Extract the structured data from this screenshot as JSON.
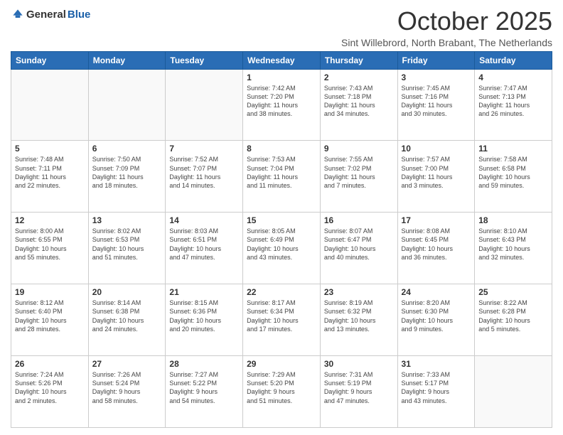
{
  "logo": {
    "general": "General",
    "blue": "Blue"
  },
  "title": "October 2025",
  "location": "Sint Willebrord, North Brabant, The Netherlands",
  "days_of_week": [
    "Sunday",
    "Monday",
    "Tuesday",
    "Wednesday",
    "Thursday",
    "Friday",
    "Saturday"
  ],
  "weeks": [
    [
      {
        "day": "",
        "info": ""
      },
      {
        "day": "",
        "info": ""
      },
      {
        "day": "",
        "info": ""
      },
      {
        "day": "1",
        "info": "Sunrise: 7:42 AM\nSunset: 7:20 PM\nDaylight: 11 hours\nand 38 minutes."
      },
      {
        "day": "2",
        "info": "Sunrise: 7:43 AM\nSunset: 7:18 PM\nDaylight: 11 hours\nand 34 minutes."
      },
      {
        "day": "3",
        "info": "Sunrise: 7:45 AM\nSunset: 7:16 PM\nDaylight: 11 hours\nand 30 minutes."
      },
      {
        "day": "4",
        "info": "Sunrise: 7:47 AM\nSunset: 7:13 PM\nDaylight: 11 hours\nand 26 minutes."
      }
    ],
    [
      {
        "day": "5",
        "info": "Sunrise: 7:48 AM\nSunset: 7:11 PM\nDaylight: 11 hours\nand 22 minutes."
      },
      {
        "day": "6",
        "info": "Sunrise: 7:50 AM\nSunset: 7:09 PM\nDaylight: 11 hours\nand 18 minutes."
      },
      {
        "day": "7",
        "info": "Sunrise: 7:52 AM\nSunset: 7:07 PM\nDaylight: 11 hours\nand 14 minutes."
      },
      {
        "day": "8",
        "info": "Sunrise: 7:53 AM\nSunset: 7:04 PM\nDaylight: 11 hours\nand 11 minutes."
      },
      {
        "day": "9",
        "info": "Sunrise: 7:55 AM\nSunset: 7:02 PM\nDaylight: 11 hours\nand 7 minutes."
      },
      {
        "day": "10",
        "info": "Sunrise: 7:57 AM\nSunset: 7:00 PM\nDaylight: 11 hours\nand 3 minutes."
      },
      {
        "day": "11",
        "info": "Sunrise: 7:58 AM\nSunset: 6:58 PM\nDaylight: 10 hours\nand 59 minutes."
      }
    ],
    [
      {
        "day": "12",
        "info": "Sunrise: 8:00 AM\nSunset: 6:55 PM\nDaylight: 10 hours\nand 55 minutes."
      },
      {
        "day": "13",
        "info": "Sunrise: 8:02 AM\nSunset: 6:53 PM\nDaylight: 10 hours\nand 51 minutes."
      },
      {
        "day": "14",
        "info": "Sunrise: 8:03 AM\nSunset: 6:51 PM\nDaylight: 10 hours\nand 47 minutes."
      },
      {
        "day": "15",
        "info": "Sunrise: 8:05 AM\nSunset: 6:49 PM\nDaylight: 10 hours\nand 43 minutes."
      },
      {
        "day": "16",
        "info": "Sunrise: 8:07 AM\nSunset: 6:47 PM\nDaylight: 10 hours\nand 40 minutes."
      },
      {
        "day": "17",
        "info": "Sunrise: 8:08 AM\nSunset: 6:45 PM\nDaylight: 10 hours\nand 36 minutes."
      },
      {
        "day": "18",
        "info": "Sunrise: 8:10 AM\nSunset: 6:43 PM\nDaylight: 10 hours\nand 32 minutes."
      }
    ],
    [
      {
        "day": "19",
        "info": "Sunrise: 8:12 AM\nSunset: 6:40 PM\nDaylight: 10 hours\nand 28 minutes."
      },
      {
        "day": "20",
        "info": "Sunrise: 8:14 AM\nSunset: 6:38 PM\nDaylight: 10 hours\nand 24 minutes."
      },
      {
        "day": "21",
        "info": "Sunrise: 8:15 AM\nSunset: 6:36 PM\nDaylight: 10 hours\nand 20 minutes."
      },
      {
        "day": "22",
        "info": "Sunrise: 8:17 AM\nSunset: 6:34 PM\nDaylight: 10 hours\nand 17 minutes."
      },
      {
        "day": "23",
        "info": "Sunrise: 8:19 AM\nSunset: 6:32 PM\nDaylight: 10 hours\nand 13 minutes."
      },
      {
        "day": "24",
        "info": "Sunrise: 8:20 AM\nSunset: 6:30 PM\nDaylight: 10 hours\nand 9 minutes."
      },
      {
        "day": "25",
        "info": "Sunrise: 8:22 AM\nSunset: 6:28 PM\nDaylight: 10 hours\nand 5 minutes."
      }
    ],
    [
      {
        "day": "26",
        "info": "Sunrise: 7:24 AM\nSunset: 5:26 PM\nDaylight: 10 hours\nand 2 minutes."
      },
      {
        "day": "27",
        "info": "Sunrise: 7:26 AM\nSunset: 5:24 PM\nDaylight: 9 hours\nand 58 minutes."
      },
      {
        "day": "28",
        "info": "Sunrise: 7:27 AM\nSunset: 5:22 PM\nDaylight: 9 hours\nand 54 minutes."
      },
      {
        "day": "29",
        "info": "Sunrise: 7:29 AM\nSunset: 5:20 PM\nDaylight: 9 hours\nand 51 minutes."
      },
      {
        "day": "30",
        "info": "Sunrise: 7:31 AM\nSunset: 5:19 PM\nDaylight: 9 hours\nand 47 minutes."
      },
      {
        "day": "31",
        "info": "Sunrise: 7:33 AM\nSunset: 5:17 PM\nDaylight: 9 hours\nand 43 minutes."
      },
      {
        "day": "",
        "info": ""
      }
    ]
  ]
}
